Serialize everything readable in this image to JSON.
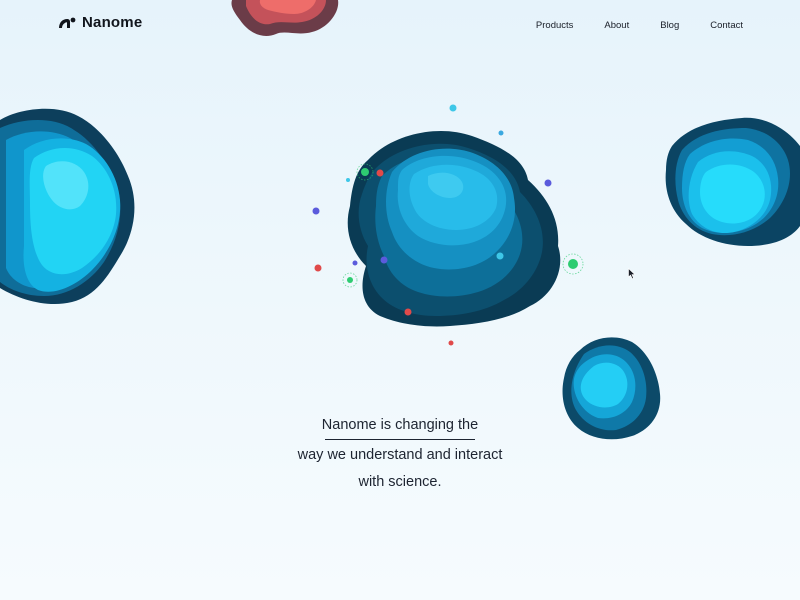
{
  "header": {
    "logo_text": "Nanome",
    "nav": [
      "Products",
      "About",
      "Blog",
      "Contact"
    ]
  },
  "hero": {
    "lines": [
      "Nanome is changing the",
      "way we understand and interact",
      "with science."
    ]
  },
  "colors": {
    "background": "#e8f4fb",
    "molecule_dark": "#0b4a66",
    "molecule_mid": "#0f7fb5",
    "molecule_light": "#18c8f0",
    "molecule_red": "#e2625f",
    "dot_green": "#2ecc71",
    "dot_red": "#e04a4a",
    "dot_purple": "#5b5bdc",
    "dot_cyan": "#3ec7e8"
  },
  "icons": [
    "nanome-logo-icon",
    "cursor-icon"
  ]
}
